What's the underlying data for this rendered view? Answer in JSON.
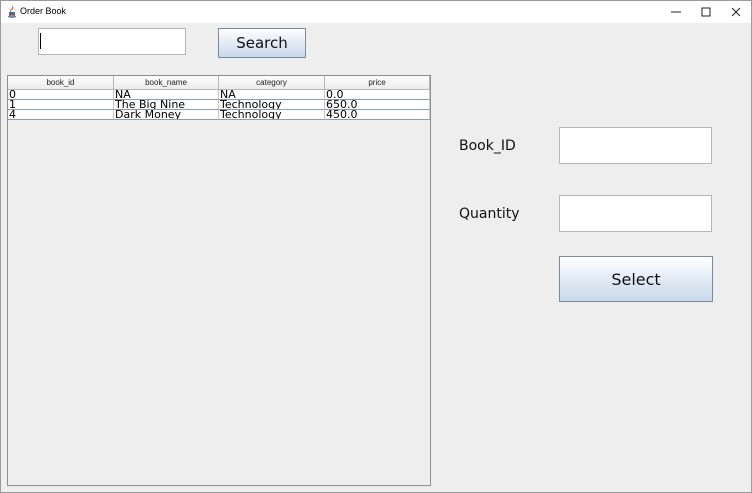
{
  "window": {
    "title": "Order Book",
    "minimize_icon": "minimize-icon",
    "maximize_icon": "maximize-icon",
    "close_icon": "close-icon"
  },
  "search": {
    "value": "",
    "button_label": "Search"
  },
  "table": {
    "columns": [
      "book_id",
      "book_name",
      "category",
      "price"
    ],
    "rows": [
      [
        "0",
        "NA",
        "NA",
        "0.0"
      ],
      [
        "1",
        "The Big Nine",
        "Technology",
        "650.0"
      ],
      [
        "4",
        "Dark Money",
        "Technology",
        "450.0"
      ]
    ]
  },
  "form": {
    "book_id_label": "Book_ID",
    "book_id_value": "",
    "quantity_label": "Quantity",
    "quantity_value": "",
    "select_label": "Select"
  }
}
